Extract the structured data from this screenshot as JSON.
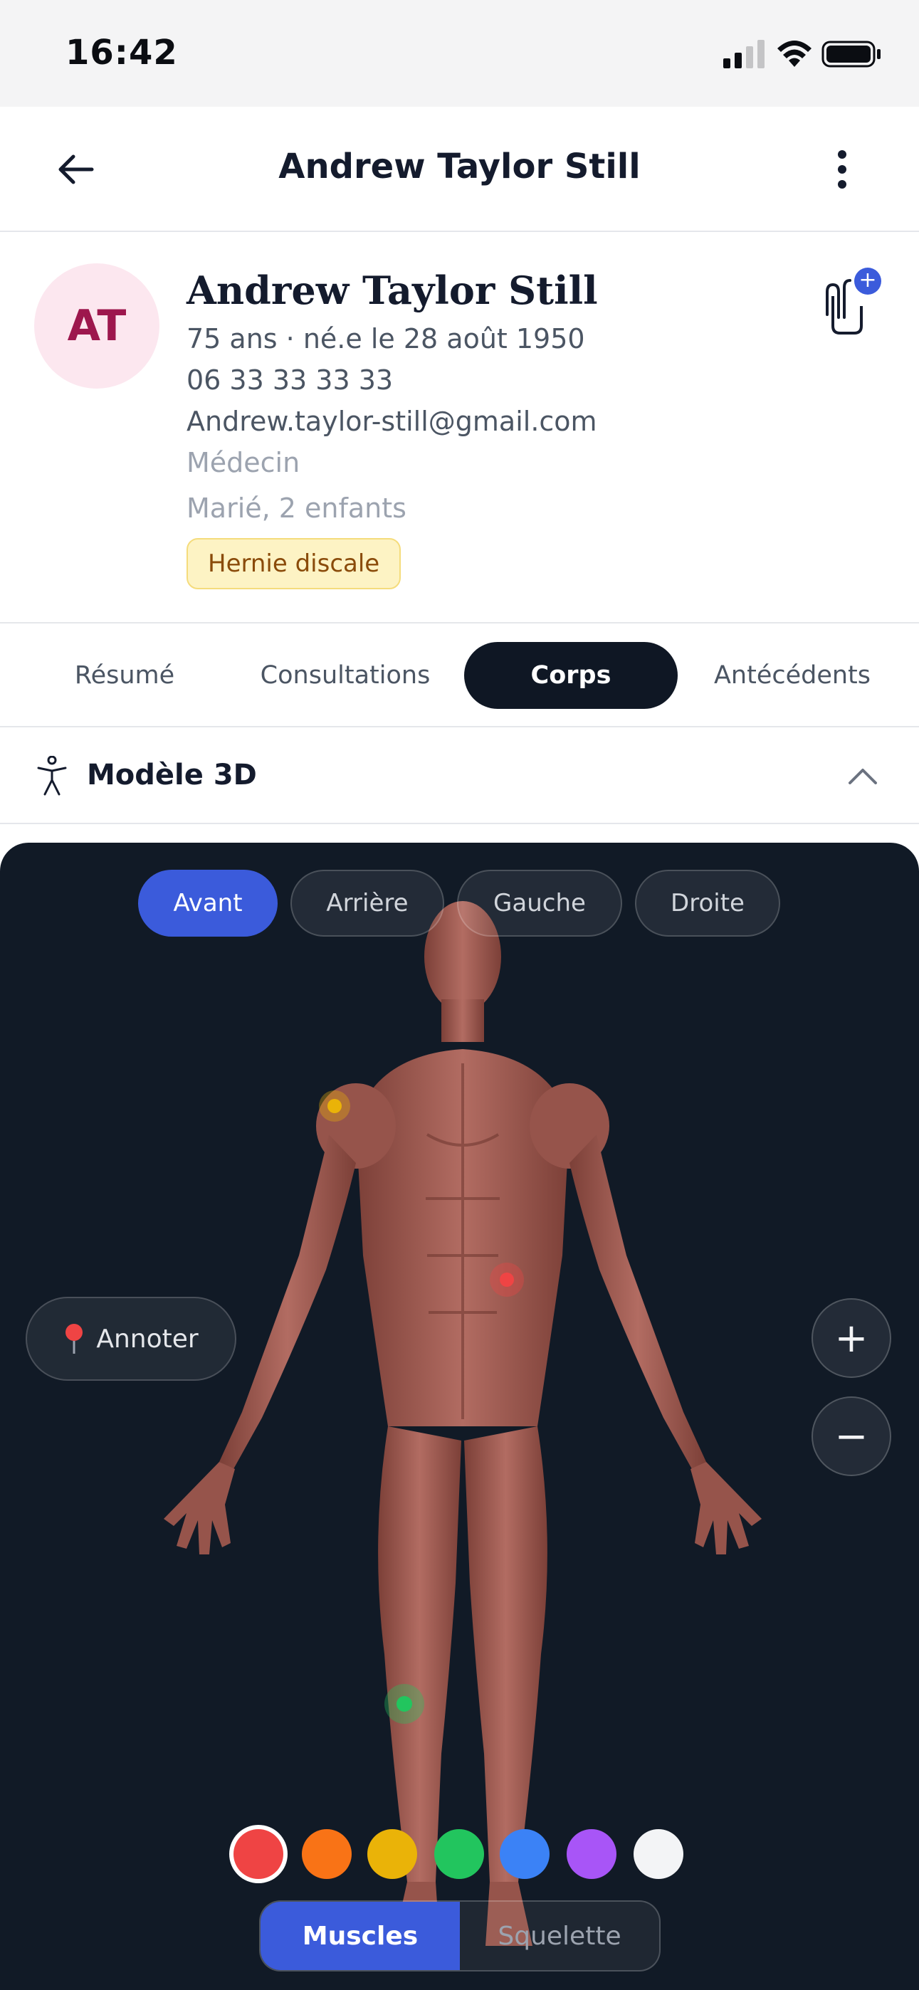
{
  "status_bar": {
    "time": "16:42"
  },
  "nav": {
    "title": "Andrew Taylor Still"
  },
  "patient": {
    "initials": "AT",
    "name": "Andrew Taylor Still",
    "age_birth": "75 ans · né.e le 28 août 1950",
    "phone": "06 33 33 33 33",
    "email": "Andrew.taylor-still@gmail.com",
    "profession": "Médecin",
    "family": "Marié, 2 enfants",
    "tag": "Hernie discale",
    "attach_badge": "+"
  },
  "tabs": [
    {
      "label": "Résumé"
    },
    {
      "label": "Consultations"
    },
    {
      "label": "Corps"
    },
    {
      "label": "Antécédents"
    }
  ],
  "active_tab": "Corps",
  "section": {
    "title": "Modèle 3D"
  },
  "viewer": {
    "views": [
      {
        "label": "Avant"
      },
      {
        "label": "Arrière"
      },
      {
        "label": "Gauche"
      },
      {
        "label": "Droite"
      }
    ],
    "active_view": "Avant",
    "annotate_label": "Annoter",
    "zoom_in": "+",
    "zoom_out": "−",
    "colors": [
      "#ef4444",
      "#f97316",
      "#eab308",
      "#22c55e",
      "#3b82f6",
      "#a855f7",
      "#f3f4f6"
    ],
    "selected_color": "#ef4444",
    "annotation_markers": [
      {
        "region": "right-shoulder",
        "color": "#eab308"
      },
      {
        "region": "left-abdomen",
        "color": "#ef4444"
      },
      {
        "region": "right-knee",
        "color": "#22c55e"
      }
    ],
    "layers": [
      {
        "label": "Muscles"
      },
      {
        "label": "Squelette"
      }
    ],
    "active_layer": "Muscles"
  }
}
